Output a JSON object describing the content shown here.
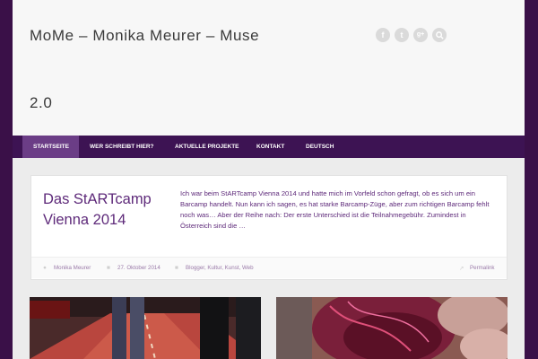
{
  "site": {
    "title_line1": "MoMe – Monika Meurer – Muse",
    "title_line2": "2.0"
  },
  "social": [
    {
      "name": "facebook-icon",
      "glyph": "f"
    },
    {
      "name": "twitter-icon",
      "glyph": "t"
    },
    {
      "name": "googleplus-icon",
      "glyph": "g+"
    },
    {
      "name": "search-icon",
      "glyph": ""
    }
  ],
  "nav": {
    "items": [
      {
        "label": "Startseite",
        "active": true
      },
      {
        "label": "Wer schreibt hier?"
      },
      {
        "label": "Aktuelle Projekte"
      },
      {
        "label": "Kontakt"
      },
      {
        "label": "Deutsch"
      }
    ]
  },
  "post": {
    "title": "Das StARTcamp Vienna 2014",
    "excerpt": "Ich war beim StARTcamp Vienna 2014 und hatte mich im Vorfeld schon gefragt, ob es sich um ein Barcamp handelt. Nun kann ich sagen, es hat starke Barcamp-Züge, aber zum richtigen Barcamp fehlt noch was… Aber der Reihe nach: Der erste Unterschied ist die Teilnahmegebühr. Zumindest in Österreich sind die …",
    "author": "Monika Meurer",
    "date": "27. Oktober 2014",
    "categories": "Blogger, Kultur, Kunst, Web",
    "permalink": "Permalink"
  },
  "colors": {
    "background": "#3a1048",
    "nav": "#3d1353",
    "nav_active": "#6b3d86",
    "accent": "#5e2a7a"
  }
}
